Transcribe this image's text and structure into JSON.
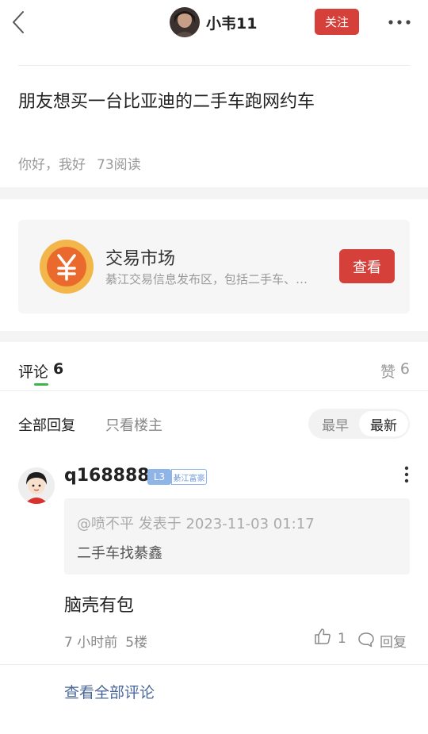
{
  "header": {
    "back_icon": "chevron-left-icon",
    "author_name": "小韦11",
    "follow_label": "关注",
    "more_icon": "more-horizontal-icon"
  },
  "post": {
    "title": "朋友想买一台比亚迪的二手车跑网约车",
    "greeting": "你好，我好",
    "reads": "73阅读"
  },
  "market_card": {
    "icon": "yuan-coin-icon",
    "title": "交易市场",
    "description": "綦江交易信息发布区，包括二手车、二手房等",
    "button_label": "查看"
  },
  "comments_header": {
    "comments_label": "评论",
    "comments_count": "6",
    "likes_label": "赞",
    "likes_count": "6"
  },
  "filters": {
    "all_replies": "全部回复",
    "op_only": "只看楼主",
    "sort_earliest": "最早",
    "sort_latest": "最新"
  },
  "comment": {
    "username": "q168888",
    "level": "L3",
    "title_badge": "綦江富豪",
    "quote_author": "@喷不平 发表于 2023-11-03 01:17",
    "quote_text": "二手车找綦鑫",
    "body": "脑壳有包",
    "time": "7 小时前",
    "floor": "5楼",
    "likes": "1",
    "reply_label": "回复"
  },
  "footer": {
    "view_all_label": "查看全部评论"
  },
  "colors": {
    "accent_red": "#d6403a",
    "tab_indicator_green": "#3bb54a",
    "link_blue": "#4a6799",
    "coin_orange": "#f2a33a"
  }
}
